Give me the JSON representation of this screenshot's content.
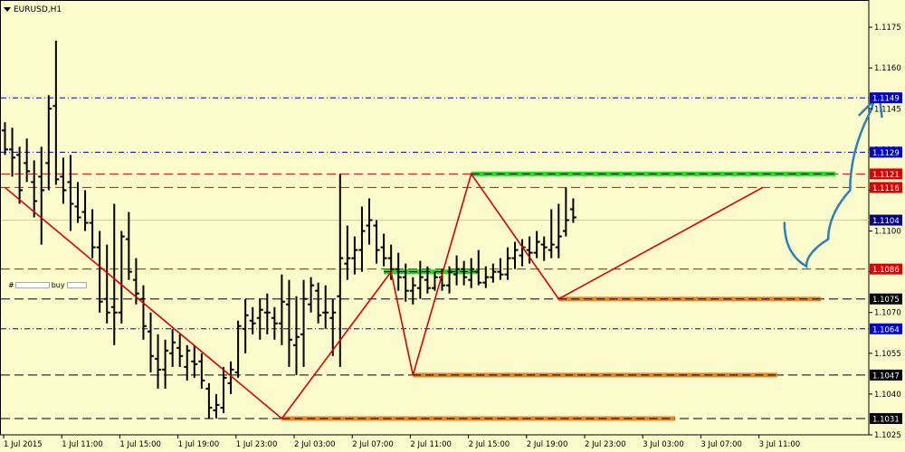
{
  "header": {
    "symbol": "EURUSD,H1"
  },
  "overlay": {
    "prefix": "#",
    "label": "buy"
  },
  "chart_data": {
    "type": "ohlc",
    "ylim": [
      1.1025,
      1.1185
    ],
    "price_ticks": [
      "1.1175",
      "1.1160",
      "1.1145",
      "1.1130",
      "1.1115",
      "1.1100",
      "1.1085",
      "1.1070",
      "1.1055",
      "1.1040",
      "1.1025"
    ],
    "time_ticks": [
      "1 Jul 2015",
      "1 Jul 11:00",
      "1 Jul 15:00",
      "1 Jul 19:00",
      "1 Jul 23:00",
      "2 Jul 03:00",
      "2 Jul 07:00",
      "2 Jul 11:00",
      "2 Jul 15:00",
      "2 Jul 19:00",
      "2 Jul 23:00",
      "3 Jul 03:00",
      "3 Jul 07:00",
      "3 Jul 11:00"
    ],
    "bars": [
      [
        1.1137,
        1.114,
        1.1128,
        1.113
      ],
      [
        1.113,
        1.1138,
        1.112,
        1.1127
      ],
      [
        1.1128,
        1.1131,
        1.111,
        1.1115
      ],
      [
        1.1125,
        1.1134,
        1.1118,
        1.1122
      ],
      [
        1.1118,
        1.1126,
        1.1105,
        1.1111
      ],
      [
        1.112,
        1.1131,
        1.1095,
        1.1115
      ],
      [
        1.1125,
        1.115,
        1.1115,
        1.1145
      ],
      [
        1.1146,
        1.117,
        1.1117,
        1.1119
      ],
      [
        1.112,
        1.1127,
        1.111,
        1.1115
      ],
      [
        1.1118,
        1.1128,
        1.11,
        1.111
      ],
      [
        1.1109,
        1.1118,
        1.1103,
        1.1105
      ],
      [
        1.1107,
        1.1115,
        1.11,
        1.1103
      ],
      [
        1.1103,
        1.1108,
        1.109,
        1.1094
      ],
      [
        1.1094,
        1.11,
        1.107,
        1.1074
      ],
      [
        1.1075,
        1.1095,
        1.1066,
        1.107
      ],
      [
        1.1072,
        1.111,
        1.1058,
        1.107
      ],
      [
        1.107,
        1.11,
        1.1066,
        1.1098
      ],
      [
        1.1097,
        1.1107,
        1.1082,
        1.1085
      ],
      [
        1.1082,
        1.109,
        1.1073,
        1.1077
      ],
      [
        1.1075,
        1.108,
        1.106,
        1.1065
      ],
      [
        1.1063,
        1.107,
        1.1048,
        1.1054
      ],
      [
        1.1053,
        1.1062,
        1.1042,
        1.1049
      ],
      [
        1.1049,
        1.106,
        1.1042,
        1.1056
      ],
      [
        1.1055,
        1.1064,
        1.105,
        1.1059
      ],
      [
        1.1057,
        1.1062,
        1.105,
        1.1054
      ],
      [
        1.105,
        1.1058,
        1.1045,
        1.1056
      ],
      [
        1.1052,
        1.1058,
        1.1046,
        1.1051
      ],
      [
        1.1052,
        1.1055,
        1.1042,
        1.1045
      ],
      [
        1.1042,
        1.1044,
        1.1031,
        1.1035
      ],
      [
        1.1034,
        1.104,
        1.1031,
        1.1036
      ],
      [
        1.1035,
        1.105,
        1.1033,
        1.1046
      ],
      [
        1.1044,
        1.1052,
        1.104,
        1.1049
      ],
      [
        1.1048,
        1.1067,
        1.1046,
        1.1065
      ],
      [
        1.1064,
        1.1075,
        1.1055,
        1.1069
      ],
      [
        1.1067,
        1.1072,
        1.1062,
        1.1066
      ],
      [
        1.1068,
        1.1075,
        1.106,
        1.1071
      ],
      [
        1.107,
        1.1077,
        1.1062,
        1.107
      ],
      [
        1.1068,
        1.1072,
        1.106,
        1.1066
      ],
      [
        1.1066,
        1.1084,
        1.1058,
        1.1074
      ],
      [
        1.1073,
        1.1082,
        1.105,
        1.106
      ],
      [
        1.1058,
        1.1076,
        1.1047,
        1.1061
      ],
      [
        1.1062,
        1.1082,
        1.105,
        1.1075
      ],
      [
        1.1073,
        1.1083,
        1.107,
        1.108
      ],
      [
        1.1078,
        1.1081,
        1.1066,
        1.1069
      ],
      [
        1.107,
        1.108,
        1.1064,
        1.107
      ],
      [
        1.1068,
        1.1075,
        1.1054,
        1.107
      ],
      [
        1.1076,
        1.1121,
        1.105,
        1.109
      ],
      [
        1.1088,
        1.1102,
        1.1082,
        1.109
      ],
      [
        1.109,
        1.1098,
        1.1084,
        1.1093
      ],
      [
        1.1093,
        1.1109,
        1.1085,
        1.11
      ],
      [
        1.1102,
        1.1112,
        1.1095,
        1.1104
      ],
      [
        1.1102,
        1.1104,
        1.1088,
        1.1093
      ],
      [
        1.1094,
        1.1099,
        1.1087,
        1.109
      ],
      [
        1.109,
        1.1095,
        1.1082,
        1.1086
      ],
      [
        1.1086,
        1.1092,
        1.1078,
        1.1083
      ],
      [
        1.1083,
        1.1088,
        1.1074,
        1.1078
      ],
      [
        1.1078,
        1.1083,
        1.1073,
        1.108
      ],
      [
        1.1079,
        1.1089,
        1.1075,
        1.1083
      ],
      [
        1.1082,
        1.1087,
        1.1077,
        1.1079
      ],
      [
        1.1079,
        1.1085,
        1.1078,
        1.1083
      ],
      [
        1.1083,
        1.1086,
        1.1078,
        1.108
      ],
      [
        1.108,
        1.1087,
        1.1077,
        1.1085
      ],
      [
        1.1084,
        1.1091,
        1.108,
        1.1086
      ],
      [
        1.1086,
        1.1089,
        1.108,
        1.1083
      ],
      [
        1.1082,
        1.109,
        1.1079,
        1.1086
      ],
      [
        1.1085,
        1.1093,
        1.108,
        1.1081
      ],
      [
        1.1081,
        1.1087,
        1.1079,
        1.1083
      ],
      [
        1.1083,
        1.1088,
        1.1081,
        1.1085
      ],
      [
        1.1085,
        1.109,
        1.1082,
        1.1084
      ],
      [
        1.1084,
        1.1094,
        1.1082,
        1.109
      ],
      [
        1.109,
        1.1096,
        1.1086,
        1.1093
      ],
      [
        1.1091,
        1.1097,
        1.1087,
        1.1094
      ],
      [
        1.1093,
        1.1098,
        1.1088,
        1.1092
      ],
      [
        1.1092,
        1.11,
        1.109,
        1.1096
      ],
      [
        1.1095,
        1.1098,
        1.1089,
        1.1094
      ],
      [
        1.1093,
        1.1108,
        1.109,
        1.1095
      ],
      [
        1.1094,
        1.111,
        1.109,
        1.1098
      ],
      [
        1.11,
        1.1116,
        1.1098,
        1.1104
      ],
      [
        1.1108,
        1.1112,
        1.1103,
        1.1105
      ]
    ],
    "hlines": [
      {
        "price": 1.1149,
        "label": "1.1149",
        "style": "dashdot",
        "color": "#0000cc",
        "box": "#0000cc"
      },
      {
        "price": 1.1129,
        "label": "1.1129",
        "style": "dashdot",
        "color": "#0000cc",
        "box": "#0000cc"
      },
      {
        "price": 1.1121,
        "label": "1.1121",
        "style": "dashed",
        "color": "#dd0000",
        "box": "#dd0000"
      },
      {
        "price": 1.1116,
        "label": "1.1116",
        "style": "dashed",
        "color": "#dd0000",
        "box": "#dd0000"
      },
      {
        "price": 1.1104,
        "label": "1.1104",
        "style": "solid",
        "color": "#c8c8c8",
        "box": "#000080"
      },
      {
        "price": 1.1086,
        "label": "1.1086",
        "style": "dashed",
        "color": "#dd0000",
        "box": "#dd0000"
      },
      {
        "price": 1.1075,
        "label": "1.1075",
        "style": "dashed",
        "color": "#000000",
        "box": "#000000"
      },
      {
        "price": 1.1064,
        "label": "1.1064",
        "style": "dashdot",
        "color": "#0000cc",
        "box": "#0000cc"
      },
      {
        "price": 1.1047,
        "label": "1.1047",
        "style": "dashed",
        "color": "#000000",
        "box": "#000000"
      },
      {
        "price": 1.1031,
        "label": "1.1031",
        "style": "dashed",
        "color": "#000000",
        "box": "#000000"
      }
    ],
    "zigzag": [
      [
        0,
        1.1116
      ],
      [
        38,
        1.1031
      ],
      [
        53,
        1.1085
      ],
      [
        56,
        1.1047
      ],
      [
        64,
        1.1121
      ],
      [
        76,
        1.1075
      ],
      [
        104,
        1.1116
      ]
    ],
    "zones": [
      {
        "from": 64,
        "to": 114,
        "price": 1.1121,
        "color": "#22dd22"
      },
      {
        "from": 52,
        "to": 65,
        "price": 1.1085,
        "color": "#22dd22"
      },
      {
        "from": 76,
        "to": 112,
        "price": 1.1075,
        "color": "#e6862a"
      },
      {
        "from": 56,
        "to": 106,
        "price": 1.1047,
        "color": "#e6862a"
      },
      {
        "from": 38,
        "to": 92,
        "price": 1.1031,
        "color": "#e6862a"
      }
    ],
    "forecast": [
      [
        107,
        1.1103
      ],
      [
        110,
        1.1087
      ],
      [
        113,
        1.1097
      ],
      [
        116,
        1.1115
      ],
      [
        119,
        1.1145
      ],
      [
        120,
        1.115
      ]
    ],
    "colors": {
      "bar": "#000000",
      "zigzag": "#dd0000",
      "forecast": "#2d7fb8",
      "background": "#fbfbcc",
      "grid": "#c8c8c8"
    }
  }
}
